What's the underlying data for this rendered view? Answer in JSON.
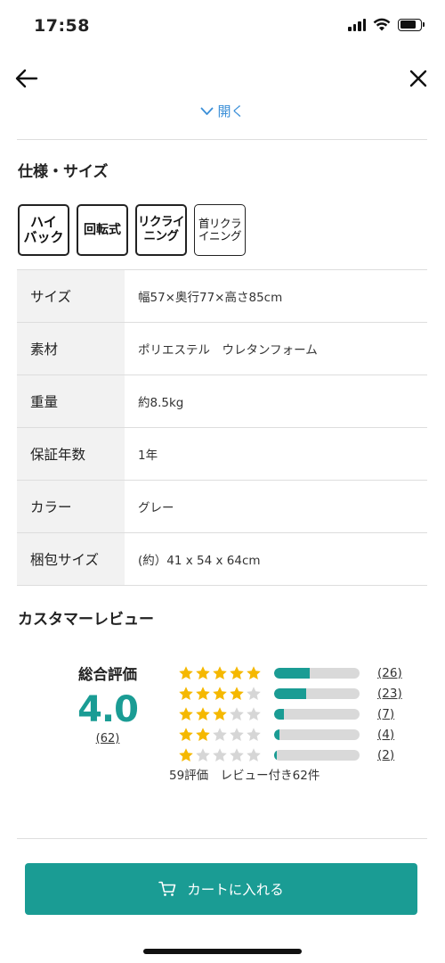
{
  "status_bar": {
    "time": "17:58"
  },
  "header": {
    "back_icon": "arrow-left-icon",
    "close_icon": "close-icon",
    "open_label": "開く",
    "open_icon": "chevron-down-icon"
  },
  "specs": {
    "title": "仕様・サイズ",
    "badges": [
      {
        "line1": "ハイ",
        "line2": "バック"
      },
      {
        "line1": "回転式",
        "line2": ""
      },
      {
        "line1": "リクライ",
        "line2": "ニング"
      },
      {
        "line1": "首リクラ",
        "line2": "イニング"
      }
    ],
    "rows": [
      {
        "key": "サイズ",
        "value": "幅57×奥行77×高さ85cm"
      },
      {
        "key": "素材",
        "value": "ポリエステル　ウレタンフォーム"
      },
      {
        "key": "重量",
        "value": "約8.5kg"
      },
      {
        "key": "保証年数",
        "value": "1年"
      },
      {
        "key": "カラー",
        "value": "グレー"
      },
      {
        "key": "梱包サイズ",
        "value": "(約）41 x 54 x 64cm"
      }
    ]
  },
  "reviews": {
    "title": "カスタマーレビュー",
    "overall_label": "総合評価",
    "score": "4.0",
    "total_count": "(62)",
    "distribution": [
      {
        "stars": 5,
        "count": "(26)",
        "fraction": 0.42
      },
      {
        "stars": 4,
        "count": "(23)",
        "fraction": 0.37
      },
      {
        "stars": 3,
        "count": "(7)",
        "fraction": 0.11
      },
      {
        "stars": 2,
        "count": "(4)",
        "fraction": 0.06
      },
      {
        "stars": 1,
        "count": "(2)",
        "fraction": 0.03
      }
    ],
    "summary": "59評価　レビュー付き62件",
    "colors": {
      "accent": "#1a9c94",
      "star_filled": "#f5b800",
      "star_empty": "#d6d6d6"
    }
  },
  "cart": {
    "label": "カートに入れる",
    "icon": "cart-icon"
  }
}
